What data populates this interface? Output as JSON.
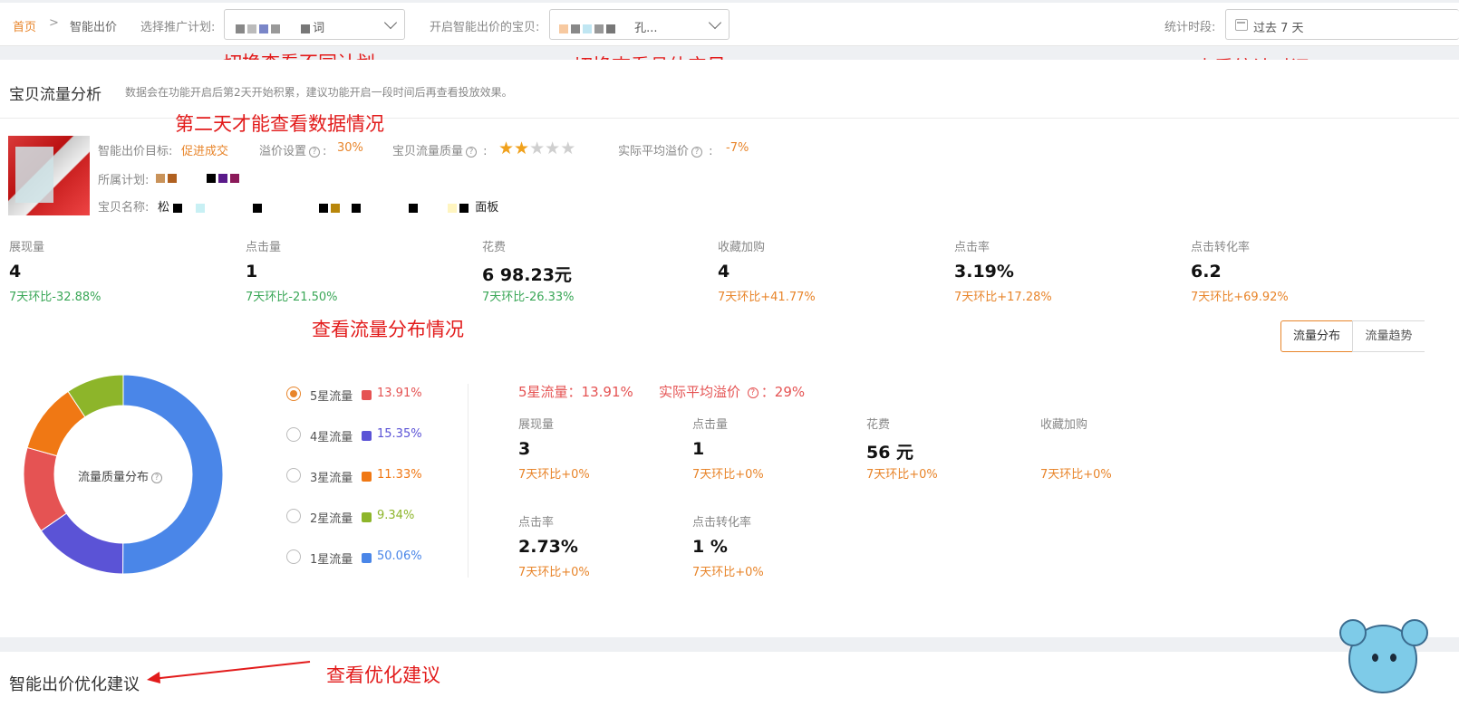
{
  "breadcrumb": {
    "home": "首页",
    "separator": ">",
    "current": "智能出价"
  },
  "filters": {
    "plan_label": "选择推广计划:",
    "plan_value": "词",
    "item_label": "开启智能出价的宝贝:",
    "item_value": "孔...",
    "period_label": "统计时段:",
    "period_value": "过去 7 天"
  },
  "annotations": {
    "switch_plan": "切换查看不同计划",
    "switch_item": "切换查看具体宝贝",
    "view_period": "查看统计时间",
    "day_two": "第二天才能查看数据情况",
    "view_distribution": "查看流量分布情况",
    "view_suggestions": "查看优化建议"
  },
  "section": {
    "title": "宝贝流量分析",
    "desc": "数据会在功能开启后第2天开始积累，建议功能开启一段时间后再查看投放效果。"
  },
  "item_info": {
    "goal_label": "智能出价目标:",
    "goal_value": "促进成交",
    "premium_label": "溢价设置",
    "premium_value": "30%",
    "quality_label": "宝贝流量质量",
    "quality_stars": 2,
    "quality_max": 5,
    "actual_premium_label": "实际平均溢价",
    "actual_premium_value": "-7%",
    "plan_label": "所属计划:",
    "name_label": "宝贝名称:",
    "name_prefix": "松",
    "name_suffix": "面板"
  },
  "metrics": [
    {
      "label": "展现量",
      "value": "4",
      "change": "7天环比-32.88%",
      "trend": "down"
    },
    {
      "label": "点击量",
      "value": "1",
      "change": "7天环比-21.50%",
      "trend": "down"
    },
    {
      "label": "花费",
      "value": "6 98.23元",
      "change": "7天环比-26.33%",
      "trend": "down"
    },
    {
      "label": "收藏加购",
      "value": "4",
      "change": "7天环比+41.77%",
      "trend": "up"
    },
    {
      "label": "点击率",
      "value": "3.19%",
      "change": "7天环比+17.28%",
      "trend": "up"
    },
    {
      "label": "点击转化率",
      "value": "6.2",
      "change": "7天环比+69.92%",
      "trend": "up"
    }
  ],
  "tabs": [
    {
      "label": "流量分布",
      "active": true
    },
    {
      "label": "流量趋势",
      "active": false
    }
  ],
  "distribution": {
    "center_label": "流量质量分布",
    "legend": [
      {
        "label": "5星流量",
        "percent": "13.91%",
        "value": 13.91,
        "color": "#e55353",
        "selected": true
      },
      {
        "label": "4星流量",
        "percent": "15.35%",
        "value": 15.35,
        "color": "#5b53d6",
        "selected": false
      },
      {
        "label": "3星流量",
        "percent": "11.33%",
        "value": 11.33,
        "color": "#f07814",
        "selected": false
      },
      {
        "label": "2星流量",
        "percent": "9.34%",
        "value": 9.34,
        "color": "#8db52a",
        "selected": false
      },
      {
        "label": "1星流量",
        "percent": "50.06%",
        "value": 50.06,
        "color": "#4a86e8",
        "selected": false
      }
    ]
  },
  "detail": {
    "heading_star": "5星流量：13.91%",
    "heading_premium": "实际平均溢价",
    "heading_premium_value": "：29%",
    "metrics": [
      {
        "label": "展现量",
        "value": "3",
        "change": "7天环比+0%"
      },
      {
        "label": "点击量",
        "value": "1",
        "change": "7天环比+0%"
      },
      {
        "label": "花费",
        "value": "56 元",
        "change": "7天环比+0%"
      },
      {
        "label": "收藏加购",
        "value": "",
        "change": "7天环比+0%"
      },
      {
        "label": "点击率",
        "value": "2.73%",
        "change": "7天环比+0%"
      },
      {
        "label": "点击转化率",
        "value": "1 %",
        "change": "7天环比+0%"
      }
    ]
  },
  "bottom": {
    "title": "智能出价优化建议"
  }
}
